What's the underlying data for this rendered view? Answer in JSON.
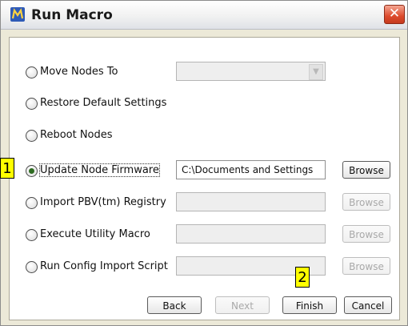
{
  "window": {
    "title": "Run Macro",
    "close_label": "✕",
    "app_icon": "m-logo-icon"
  },
  "options": [
    {
      "label": "Move Nodes To",
      "checked": false,
      "control": "combo",
      "value": "",
      "enabled": false
    },
    {
      "label": "Restore Default Settings",
      "checked": false
    },
    {
      "label": "Reboot Nodes",
      "checked": false
    },
    {
      "label": "Update Node Firmware",
      "checked": true,
      "control": "field",
      "value": "C:\\Documents and Settings",
      "enabled": true,
      "browse_label": "Browse",
      "browse_enabled": true
    },
    {
      "label": "Import PBV(tm) Registry",
      "checked": false,
      "control": "field",
      "value": "",
      "enabled": false,
      "browse_label": "Browse",
      "browse_enabled": false
    },
    {
      "label": "Execute Utility Macro",
      "checked": false,
      "control": "field",
      "value": "",
      "enabled": false,
      "browse_label": "Browse",
      "browse_enabled": false
    },
    {
      "label": "Run Config Import Script",
      "checked": false,
      "control": "field",
      "value": "",
      "enabled": false,
      "browse_label": "Browse",
      "browse_enabled": false
    }
  ],
  "buttons": {
    "back": "Back",
    "next": "Next",
    "finish": "Finish",
    "cancel": "Cancel"
  },
  "annotations": [
    "1",
    "2"
  ],
  "colors": {
    "annotation_bg": "#ffff00",
    "radio_selected": "#2e6b21",
    "close_button": "#dd4b2d"
  }
}
